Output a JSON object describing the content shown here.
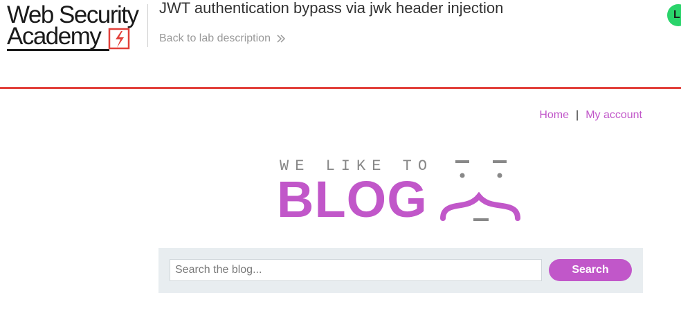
{
  "header": {
    "logo_line1": "Web Security",
    "logo_line2": "Academy",
    "lab_title": "JWT authentication bypass via jwk header injection",
    "back_link_label": "Back to lab description",
    "status_initial": "L",
    "status_color": "#2ad46b",
    "accent_color": "#e2413b"
  },
  "nav": {
    "items": [
      {
        "label": "Home"
      },
      {
        "label": "My account"
      }
    ],
    "separator": "|"
  },
  "banner": {
    "tagline": "WE LIKE TO",
    "word": "BLOG",
    "brand_color": "#c157c9"
  },
  "search": {
    "placeholder": "Search the blog...",
    "value": "",
    "button_label": "Search"
  },
  "icons": [
    "lightning-bolt-icon",
    "double-chevron-right-icon",
    "smiley-face-icon"
  ]
}
